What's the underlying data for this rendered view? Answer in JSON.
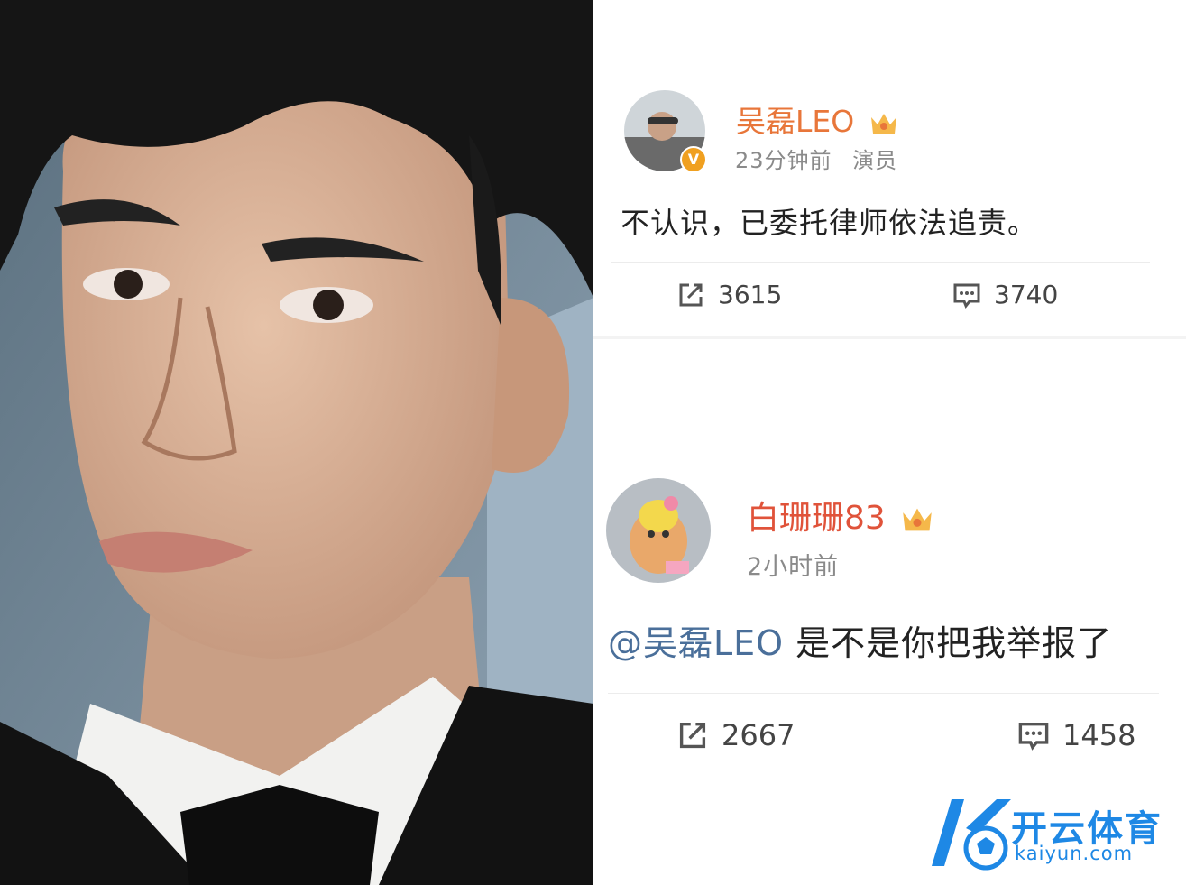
{
  "posts": [
    {
      "username": "吴磊LEO",
      "time": "23分钟前",
      "tag": "演员",
      "content": "不认识，已委托律师依法追责。",
      "reposts": "3615",
      "comments": "3740"
    },
    {
      "username": "白珊珊83",
      "time": "2小时前",
      "mention": "@吴磊LEO",
      "content": " 是不是你把我举报了",
      "reposts": "2667",
      "comments": "1458"
    }
  ],
  "watermark": {
    "name": "开云体育",
    "domain": "kaiyun.com"
  },
  "colors": {
    "username": "#e8763a",
    "mention": "#4a6f9a",
    "verified": "#f0a020",
    "brand": "#1e88e5"
  }
}
